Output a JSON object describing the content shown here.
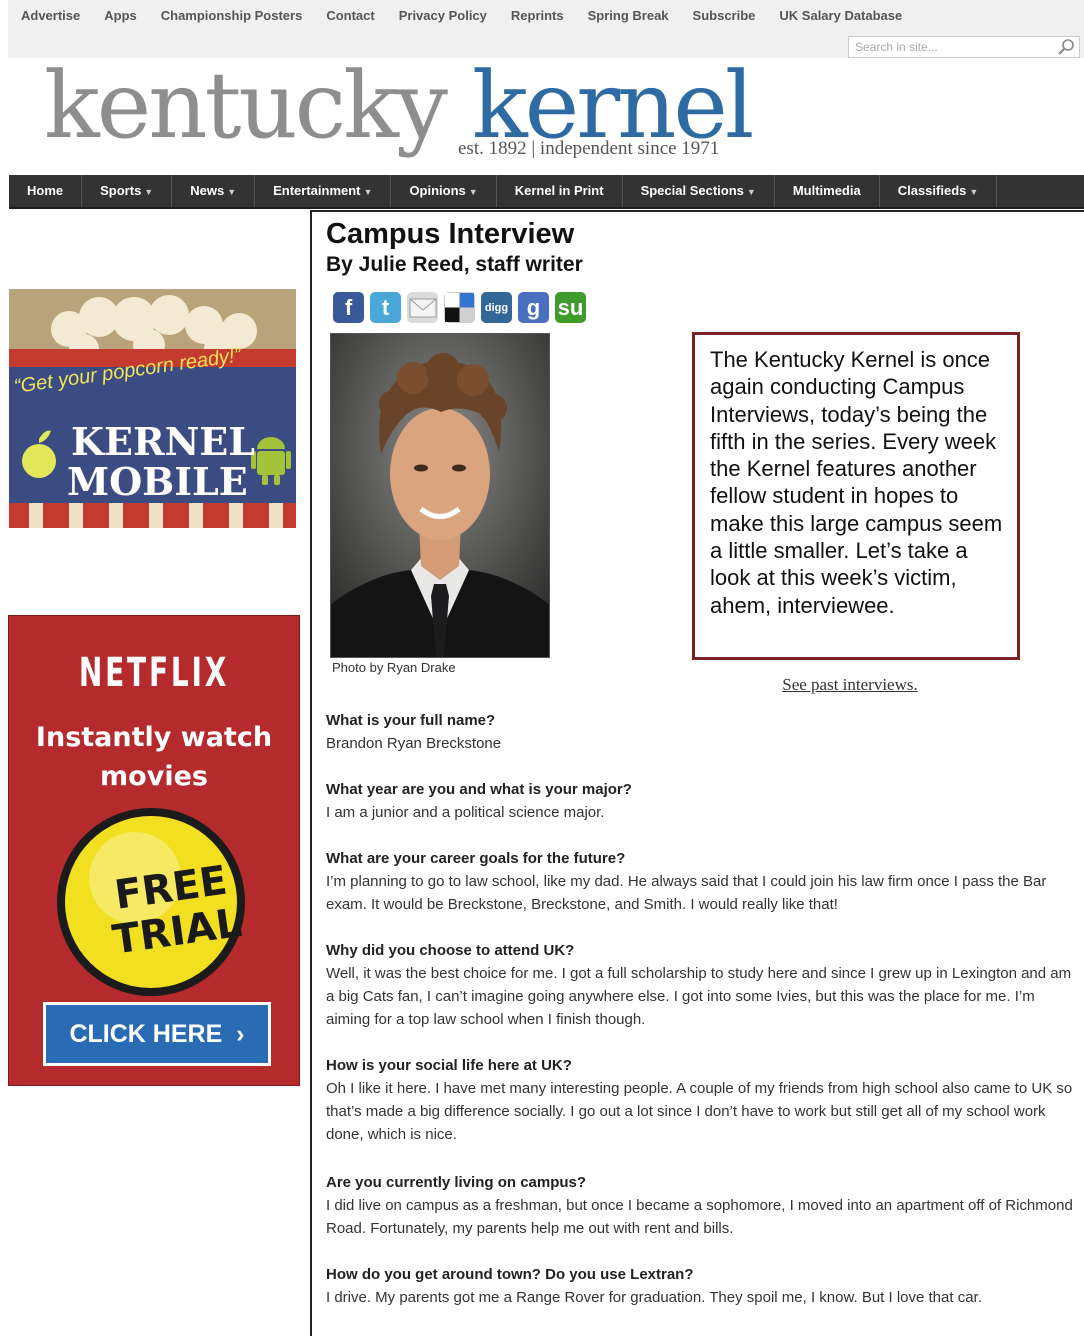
{
  "top_links": [
    "Advertise",
    "Apps",
    "Championship Posters",
    "Contact",
    "Privacy Policy",
    "Reprints",
    "Spring Break",
    "Subscribe",
    "UK Salary Database"
  ],
  "search": {
    "placeholder": "Search in site..."
  },
  "logo": {
    "word1": "kentucky",
    "word2": "kernel",
    "tagline": "est. 1892 | independent since 1971"
  },
  "nav": [
    {
      "label": "Home",
      "dropdown": false
    },
    {
      "label": "Sports",
      "dropdown": true
    },
    {
      "label": "News",
      "dropdown": true
    },
    {
      "label": "Entertainment",
      "dropdown": true
    },
    {
      "label": "Opinions",
      "dropdown": true
    },
    {
      "label": "Kernel in Print",
      "dropdown": false
    },
    {
      "label": "Special Sections",
      "dropdown": true
    },
    {
      "label": "Multimedia",
      "dropdown": false
    },
    {
      "label": "Classifieds",
      "dropdown": true
    }
  ],
  "article": {
    "title": "Campus Interview",
    "byline": "By Julie Reed, staff writer",
    "photo_credit": "Photo by Ryan Drake",
    "intro": "The Kentucky Kernel is once again conducting Campus Interviews, today’s being the fifth in the series.  Every week the Kernel features another fellow student in hopes to make this large campus seem a little smaller. Let’s take a look at this week’s victim, ahem, interviewee.",
    "past_link": "See past interviews.",
    "qa": [
      {
        "q": "What is your full name?",
        "a": "Brandon Ryan Breckstone"
      },
      {
        "q": "What year are you and what is your major?",
        "a": "I am a junior and a political science major."
      },
      {
        "q": "What are your career goals for the future?",
        "a": "I’m planning to go to law school, like my dad.  He always said that I could join his law firm once I pass the Bar exam.  It would be Breckstone, Breckstone, and Smith. I would really like that!"
      },
      {
        "q": "Why did you choose to attend UK?",
        "a": "Well, it was the best choice for me.  I got a full scholarship to study here and since I grew up in Lexington and am a big Cats fan, I can’t imagine going anywhere else.  I got into some Ivies, but this was the place for me.  I’m aiming for a top law school when I finish though."
      },
      {
        "q": "How is your social life here at UK?",
        "a": "Oh I like it here. I have met many interesting people. A couple of my friends from high school also came to UK so that’s made a big difference socially. I go out a lot since I don’t have to work but still get all of my school work done, which is nice."
      },
      {
        "q": "Are you currently living on campus?",
        "a": "I did live on campus as a freshman, but once I became a sophomore, I moved into an apartment off of Richmond Road.  Fortunately, my parents help me out with rent and bills."
      },
      {
        "q": "How do you get around town?  Do you use Lextran?",
        "a": "I drive. My parents got me a Range Rover for graduation. They spoil me, I know. But I love that car."
      }
    ]
  },
  "share_icons": [
    {
      "name": "facebook-icon",
      "glyph": "f",
      "color": "#3b5998"
    },
    {
      "name": "twitter-icon",
      "glyph": "t",
      "color": "#4aa8d8"
    },
    {
      "name": "email-icon",
      "glyph": "",
      "color": "#dcdcdc"
    },
    {
      "name": "delicious-icon",
      "glyph": "",
      "color": "#ffffff"
    },
    {
      "name": "digg-icon",
      "glyph": "digg",
      "color": "#336699"
    },
    {
      "name": "google-icon",
      "glyph": "g",
      "color": "#4a6fc0"
    },
    {
      "name": "stumbleupon-icon",
      "glyph": "su",
      "color": "#3f9b2c"
    }
  ],
  "ads": {
    "kernel_mobile": {
      "tagline": "“Get your popcorn ready!”",
      "line1": "KERNEL",
      "line2": "MOBILE"
    },
    "netflix": {
      "brand": "NETFLIX",
      "headline": "Instantly watch movies",
      "badge": "FREE TRIAL",
      "button": "CLICK HERE"
    }
  }
}
